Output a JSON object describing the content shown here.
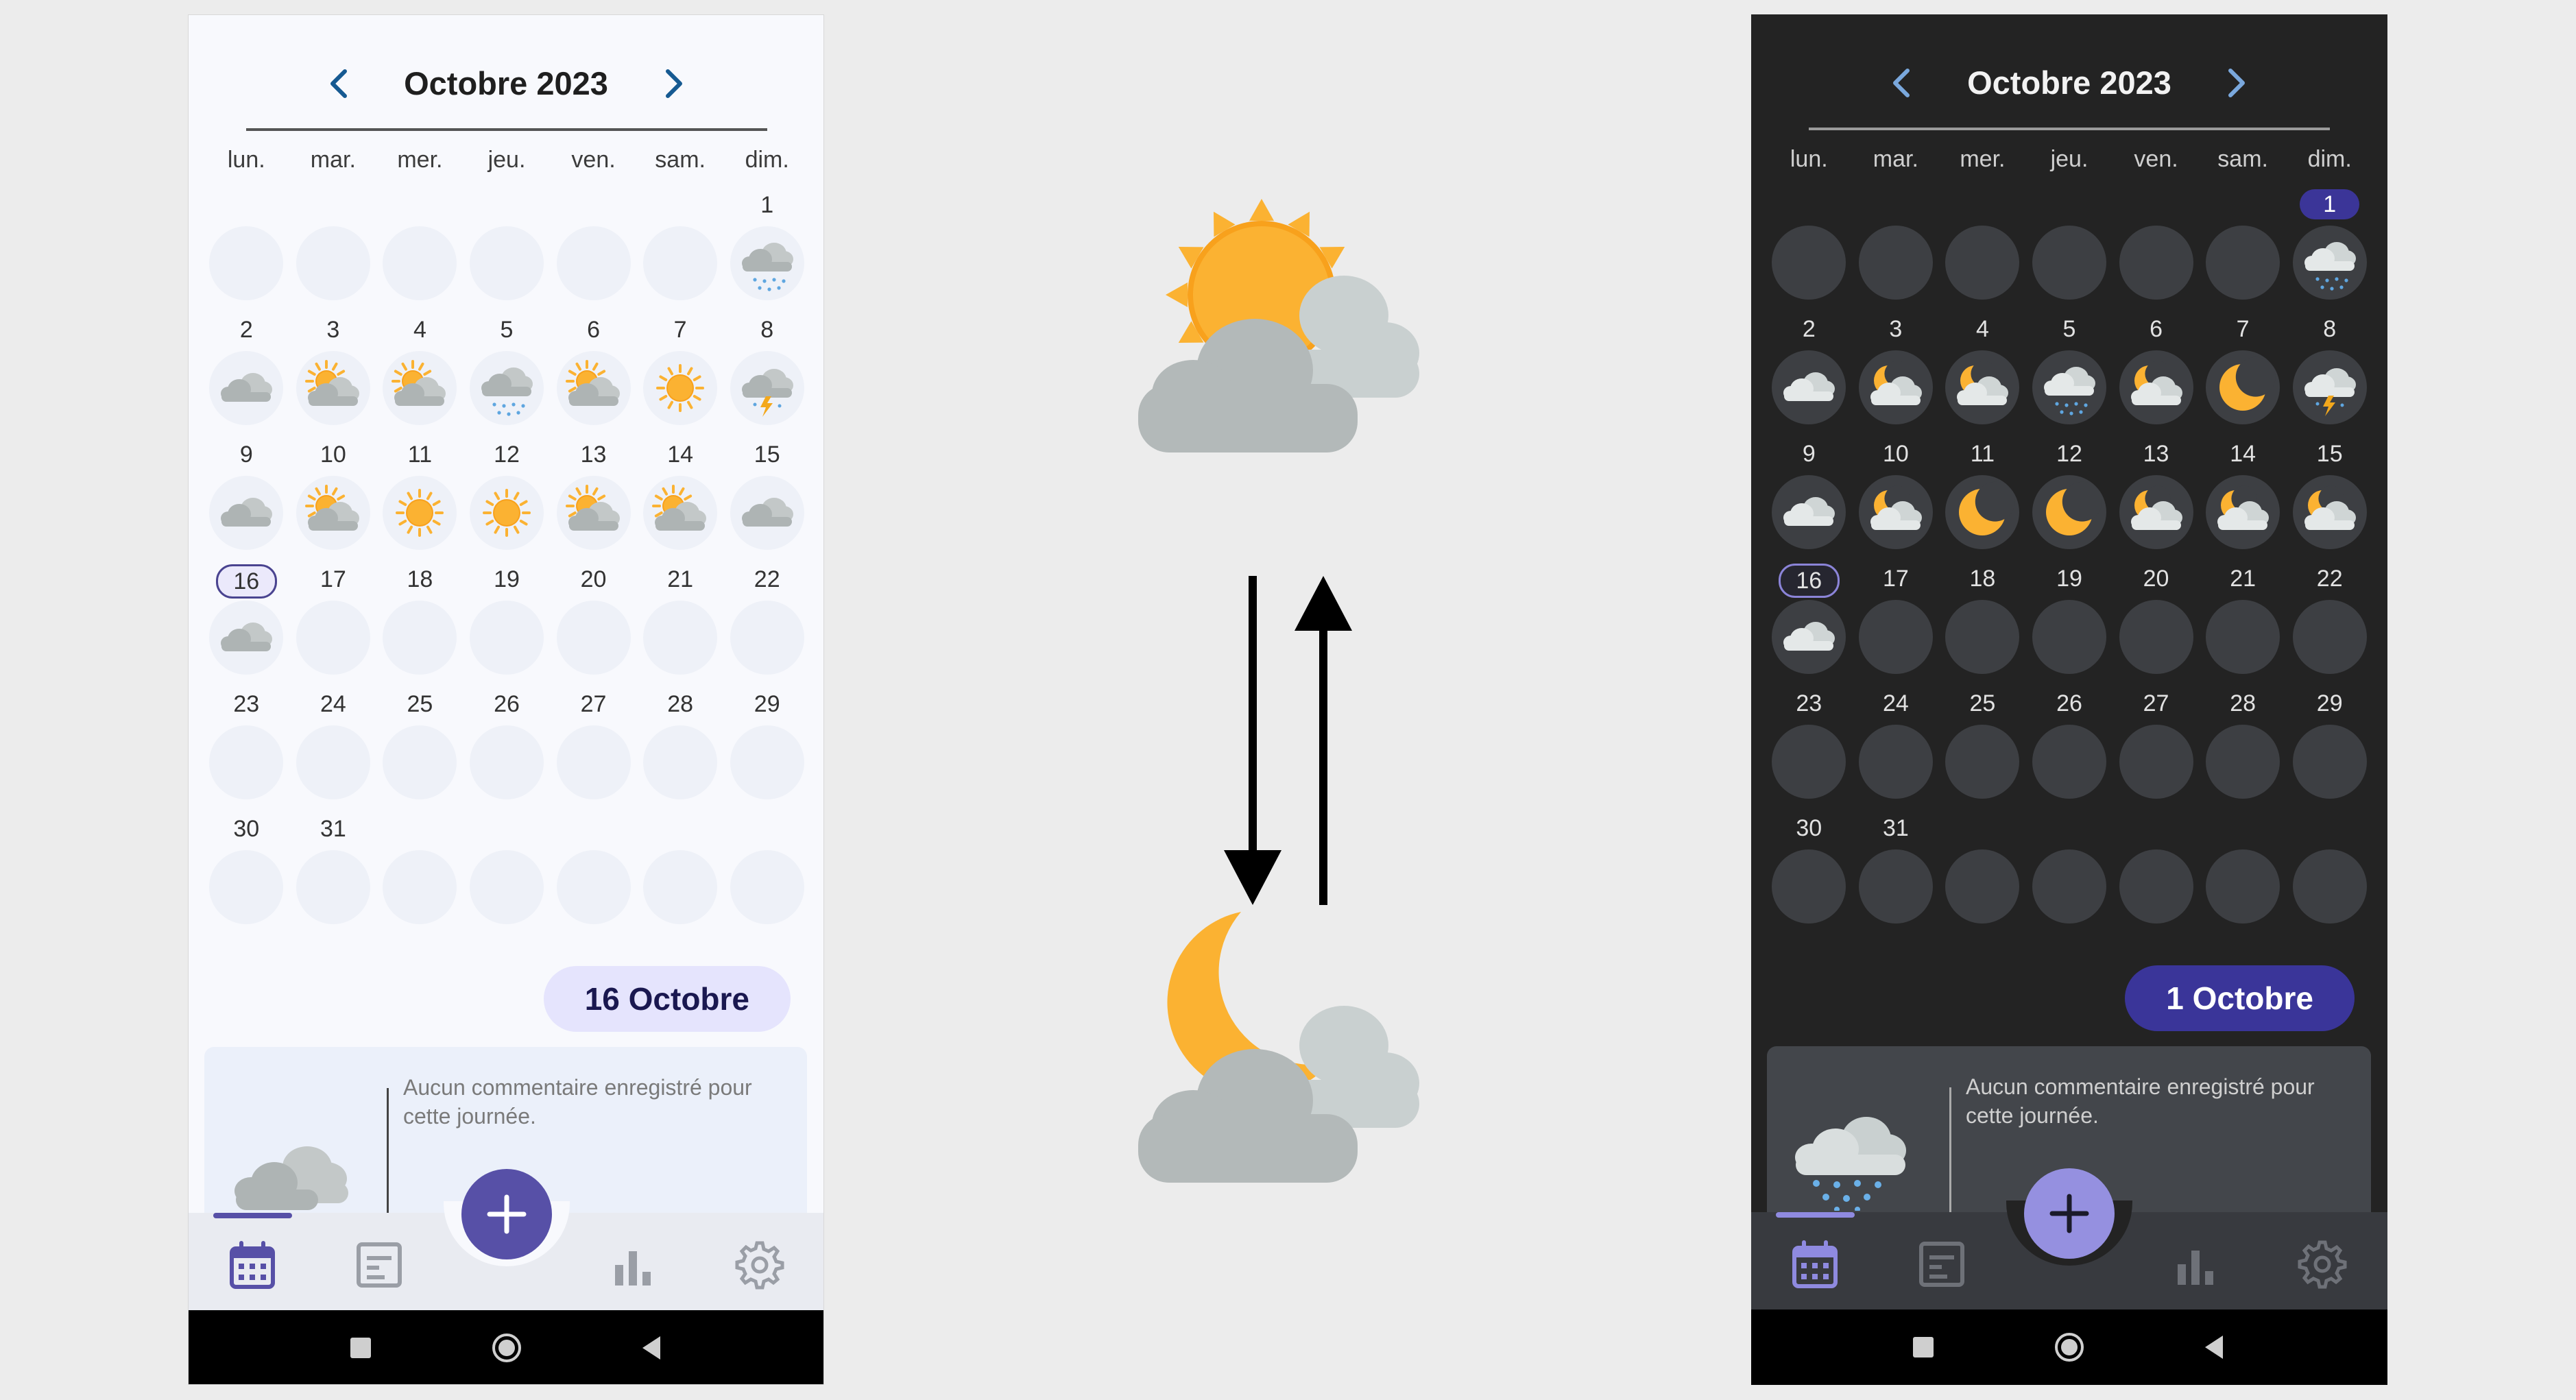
{
  "light": {
    "month_title": "Octobre 2023",
    "weekdays": [
      "lun.",
      "mar.",
      "mer.",
      "jeu.",
      "ven.",
      "sam.",
      "dim."
    ],
    "selected_date": "16 Octobre",
    "selected_day": 16,
    "highlight_day": null,
    "comment": "Aucun commentaire enregistré pour cette journée.",
    "card_icon": "cloudy-icon",
    "colors": {
      "accent": "#5750a7",
      "background": "#f8f9fd"
    }
  },
  "dark": {
    "month_title": "Octobre 2023",
    "weekdays": [
      "lun.",
      "mar.",
      "mer.",
      "jeu.",
      "ven.",
      "sam.",
      "dim."
    ],
    "selected_date": "1 Octobre",
    "selected_day": 16,
    "highlight_day": 1,
    "comment": "Aucun commentaire enregistré pour cette journée.",
    "card_icon": "rain-icon",
    "colors": {
      "accent": "#3a3599",
      "background": "#232323"
    }
  },
  "calendar": {
    "leading_blanks": 6,
    "days_in_month": 31,
    "trailing_blanks": 5,
    "light_weather": {
      "1": "rain",
      "2": "cloudy",
      "3": "partly",
      "4": "partly",
      "5": "rain",
      "6": "partly",
      "7": "sun",
      "8": "storm",
      "9": "cloudy",
      "10": "partly",
      "11": "sun",
      "12": "sun",
      "13": "partly",
      "14": "partly",
      "15": "cloudy",
      "16": "cloudy"
    },
    "dark_weather": {
      "1": "rain",
      "2": "cloudy",
      "3": "partly",
      "4": "partly",
      "5": "rain",
      "6": "partly",
      "7": "sun",
      "8": "storm",
      "9": "cloudy",
      "10": "partly",
      "11": "sun",
      "12": "sun",
      "13": "partly",
      "14": "partly",
      "15": "partly",
      "16": "cloudy"
    }
  },
  "center_icons": [
    "sun-cloud-icon",
    "swap-arrows-icon",
    "moon-cloud-icon"
  ],
  "nav_tabs": [
    "calendar-tab",
    "notes-tab",
    "add-button",
    "stats-tab",
    "settings-tab"
  ],
  "system_buttons": [
    "recents-button",
    "home-button",
    "back-button"
  ]
}
